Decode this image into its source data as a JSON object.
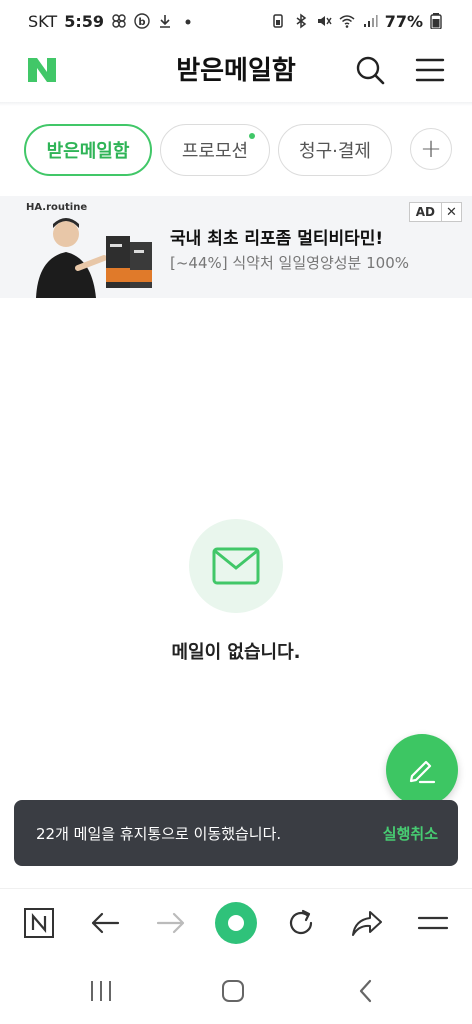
{
  "status_bar": {
    "carrier": "SKT",
    "time": "5:59",
    "battery": "77%"
  },
  "header": {
    "title": "받은메일함"
  },
  "tabs": [
    {
      "label": "받은메일함",
      "active": true
    },
    {
      "label": "프로모션",
      "has_new": true
    },
    {
      "label": "청구·결제"
    }
  ],
  "add_tab_label": "+",
  "ad": {
    "brand": "HA.routine",
    "headline": "국내 최초 리포좀 멀티비타민!",
    "sub": "[~44%] 식약처 일일영양성분 100%",
    "badge": "AD",
    "close": "✕"
  },
  "empty_state": {
    "message": "메일이 없습니다."
  },
  "snackbar": {
    "message": "22개 메일을 휴지통으로 이동했습니다.",
    "action": "실행취소"
  },
  "icons": {
    "header": [
      "naver-logo-icon",
      "search-icon",
      "hamburger-menu-icon"
    ],
    "browser": [
      "naver-home-icon",
      "back-arrow-icon",
      "forward-arrow-icon",
      "green-dot-icon",
      "refresh-icon",
      "share-icon",
      "menu-icon"
    ],
    "system_nav": [
      "recent-apps-icon",
      "home-icon",
      "back-icon"
    ]
  },
  "colors": {
    "accent": "#41c768",
    "snackbar_bg": "#3a3d43",
    "undo": "#47cc72"
  }
}
